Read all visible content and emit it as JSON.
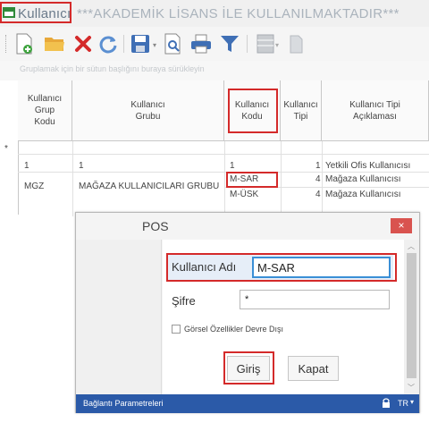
{
  "title": {
    "left": "Kullanıcı",
    "right": "***AKADEMİK LİSANS İLE KULLANILMAKTADIR***"
  },
  "toolbar": {
    "icons": [
      "new-icon",
      "open-folder-icon",
      "delete-icon",
      "refresh-icon",
      "save-icon",
      "preview-icon",
      "print-icon",
      "filter-icon",
      "layout-icon",
      "copy-icon"
    ]
  },
  "grid": {
    "group_hint": "Gruplamak için bir sütun başlığını buraya sürükleyin",
    "columns": [
      "Kullanıcı Grup Kodu",
      "Kullanıcı Grubu",
      "Kullanıcı Kodu",
      "Kullanıcı Tipi",
      "Kullanıcı Tipi Açıklaması"
    ],
    "filter_marker": "*",
    "rows": [
      {
        "grup_kodu": "1",
        "grubu": "1",
        "kodu": "1",
        "tipi": "1",
        "aciklama": "Yetkili Ofis Kullanıcısı"
      },
      {
        "grup_kodu": "MGZ",
        "grubu": "MAĞAZA KULLANICILARI GRUBU",
        "kodu": "M-SAR",
        "tipi": "4",
        "aciklama": "Mağaza Kullanıcısı"
      },
      {
        "grup_kodu": "",
        "grubu": "",
        "kodu": "M-ÜSK",
        "tipi": "4",
        "aciklama": "Mağaza Kullanıcısı"
      }
    ]
  },
  "dialog": {
    "title": "POS",
    "close": "×",
    "username_label": "Kullanıcı Adı",
    "username_value": "M-SAR",
    "password_label": "Şifre",
    "password_value": "*",
    "checkbox_label": "Görsel Özellikler Devre Dışı",
    "login_button": "Giriş",
    "close_button": "Kapat",
    "status_left": "Bağlantı Parametreleri",
    "status_lang": "TR"
  },
  "colors": {
    "highlight": "#d42a2a",
    "status_bar": "#2b5aa8",
    "close_button": "#d9534f"
  }
}
